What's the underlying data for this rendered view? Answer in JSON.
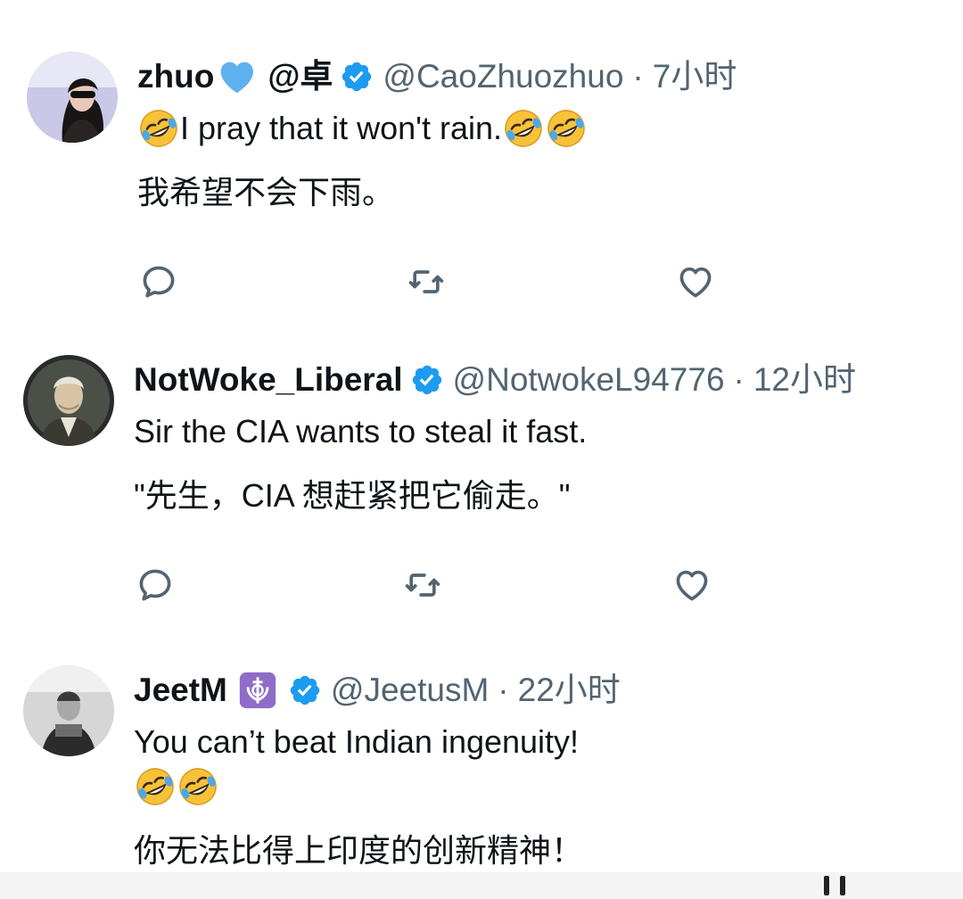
{
  "tweets": [
    {
      "name": "zhuo",
      "name_suffix": "@卓",
      "handle": "@CaoZhuozhuo",
      "separator": "·",
      "time": "7小时",
      "text_en": "I pray that it won't rain.",
      "text_zh": "我希望不会下雨。",
      "icons": {
        "emoji": "rolling-laughing-emoji",
        "badge": "verified-badge-icon",
        "heart": "blue-heart-emoji"
      }
    },
    {
      "name": "NotWoke_Liberal",
      "handle": "@NotwokeL94776",
      "separator": "·",
      "time": "12小时",
      "text_en": "Sir the CIA wants to steal it fast.",
      "text_zh": "\"先生，CIA 想赶紧把它偷走。\""
    },
    {
      "name": "JeetM",
      "handle": "@JeetusM",
      "separator": "·",
      "time": "22小时",
      "text_en": "You can’t beat Indian ingenuity!",
      "text_zh": "你无法比得上印度的创新精神！"
    }
  ],
  "colors": {
    "verified": "#1d9bf0",
    "secondary_text": "#536471",
    "icon": "#536471",
    "emoji_yellow": "#f7c23a"
  },
  "action_icons": [
    "reply-icon",
    "retweet-icon",
    "like-icon"
  ]
}
